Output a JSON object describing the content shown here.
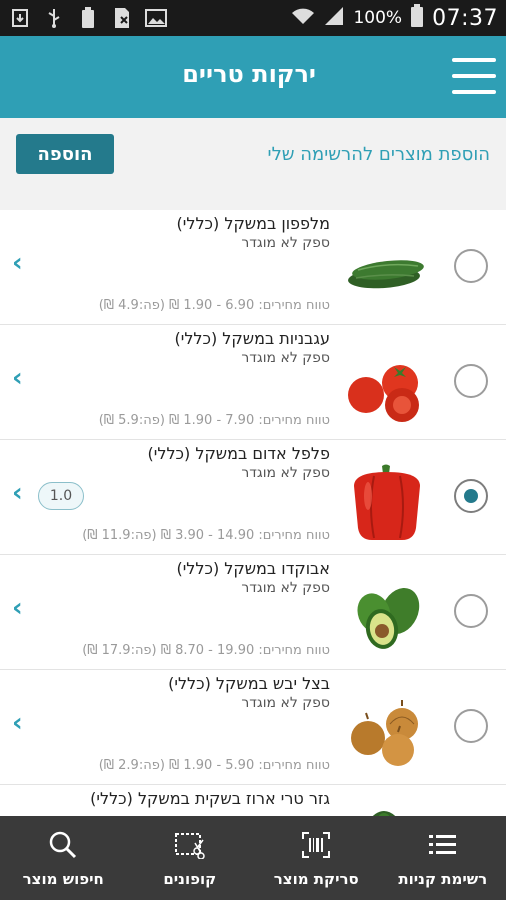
{
  "status_bar": {
    "battery_percent": "100%",
    "time": "07:37",
    "left_icons": [
      "download-icon",
      "usb-icon",
      "battery-saver-icon",
      "sim-icon",
      "image-icon"
    ]
  },
  "header": {
    "title": "ירקות טריים",
    "menu_icon": "hamburger-icon",
    "color": "#2f9fb5"
  },
  "add_bar": {
    "label": "הוספת מוצרים להרשימה שלי",
    "button_label": "הוספה",
    "button_color": "#247a8c"
  },
  "products": [
    {
      "name": "מלפפון במשקל (כללי)",
      "supplier": "ספק לא מוגדר",
      "price_range": "טווח מחירים: 6.90 - 1.90 ₪ (פה:4.9 ₪)",
      "selected": false,
      "quantity": "",
      "image_icon": "cucumber-icon"
    },
    {
      "name": "עגבניות במשקל (כללי)",
      "supplier": "ספק לא מוגדר",
      "price_range": "טווח מחירים: 7.90 - 1.90 ₪ (פה:5.9 ₪)",
      "selected": false,
      "quantity": "",
      "image_icon": "tomato-icon"
    },
    {
      "name": "פלפל אדום במשקל (כללי)",
      "supplier": "ספק לא מוגדר",
      "price_range": "טווח מחירים: 14.90 - 3.90 ₪ (פה:11.9 ₪)",
      "selected": true,
      "quantity": "1.0",
      "image_icon": "red-pepper-icon"
    },
    {
      "name": "אבוקדו במשקל (כללי)",
      "supplier": "ספק לא מוגדר",
      "price_range": "טווח מחירים: 19.90 - 8.70 ₪ (פה:17.9 ₪)",
      "selected": false,
      "quantity": "",
      "image_icon": "avocado-icon"
    },
    {
      "name": "בצל יבש במשקל (כללי)",
      "supplier": "ספק לא מוגדר",
      "price_range": "טווח מחירים: 5.90 - 1.90 ₪ (פה:2.9 ₪)",
      "selected": false,
      "quantity": "",
      "image_icon": "onion-icon"
    },
    {
      "name": "גזר טרי ארוז בשקית במשקל (כללי)",
      "supplier": "",
      "price_range": "",
      "selected": false,
      "quantity": "",
      "image_icon": "carrot-icon"
    }
  ],
  "bottom_nav": [
    {
      "label": "רשימת קניות",
      "icon": "list-icon"
    },
    {
      "label": "סריקת מוצר",
      "icon": "barcode-scan-icon"
    },
    {
      "label": "קופונים",
      "icon": "coupon-icon"
    },
    {
      "label": "חיפוש מוצר",
      "icon": "search-icon"
    }
  ]
}
